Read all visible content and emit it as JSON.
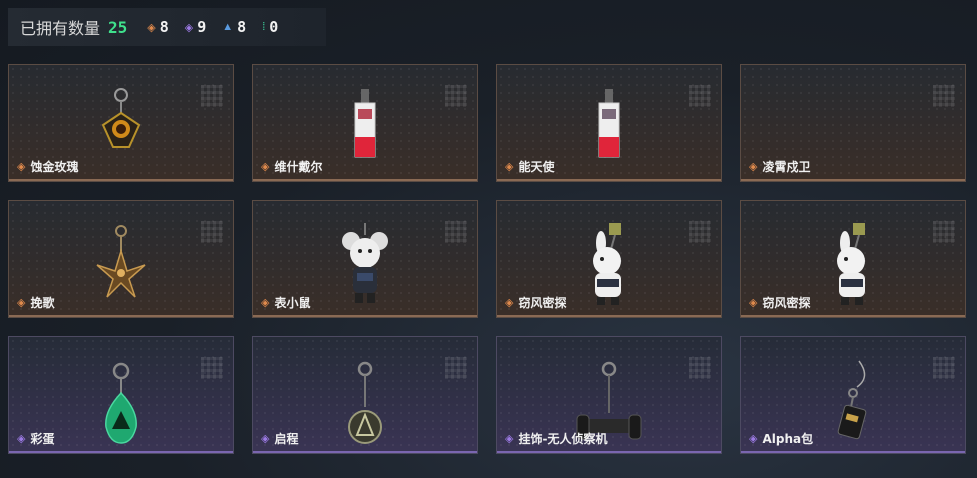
{
  "header": {
    "owned_label": "已拥有数量",
    "owned_count": "25",
    "rarities": [
      {
        "icon": "orange-diamond-icon",
        "color": "#e08a4c",
        "count": "8"
      },
      {
        "icon": "purple-diamond-icon",
        "color": "#9d7be6",
        "count": "9"
      },
      {
        "icon": "blue-triangle-icon",
        "color": "#5a9be0",
        "count": "8"
      },
      {
        "icon": "green-dots-icon",
        "color": "#3fd7a0",
        "count": "0"
      }
    ]
  },
  "items": [
    {
      "name": "蚀金玫瑰",
      "rarity": "orange",
      "icon": "rose-pendant-icon"
    },
    {
      "name": "维什戴尔",
      "rarity": "orange",
      "icon": "red-tag-charm-icon"
    },
    {
      "name": "能天使",
      "rarity": "orange",
      "icon": "red-tag-charm-icon"
    },
    {
      "name": "凌霄戍卫",
      "rarity": "orange",
      "icon": "empty-charm-icon"
    },
    {
      "name": "挽歌",
      "rarity": "orange",
      "icon": "gold-sun-pendant-icon"
    },
    {
      "name": "表小鼠",
      "rarity": "orange",
      "icon": "mouse-figure-icon"
    },
    {
      "name": "窃风密探",
      "rarity": "orange",
      "icon": "rabbit-figure-icon"
    },
    {
      "name": "窃风密探",
      "rarity": "orange",
      "icon": "rabbit-figure-icon"
    },
    {
      "name": "彩蛋",
      "rarity": "purple",
      "icon": "green-egg-charm-icon"
    },
    {
      "name": "启程",
      "rarity": "purple",
      "icon": "round-medal-charm-icon"
    },
    {
      "name": "挂饰-无人侦察机",
      "rarity": "purple",
      "icon": "drone-charm-icon"
    },
    {
      "name": "Alpha包",
      "rarity": "purple",
      "icon": "alpha-bag-charm-icon"
    }
  ],
  "colors": {
    "orange": "#e08a4c",
    "purple": "#9d7be6",
    "owned_green": "#3fe08c"
  }
}
